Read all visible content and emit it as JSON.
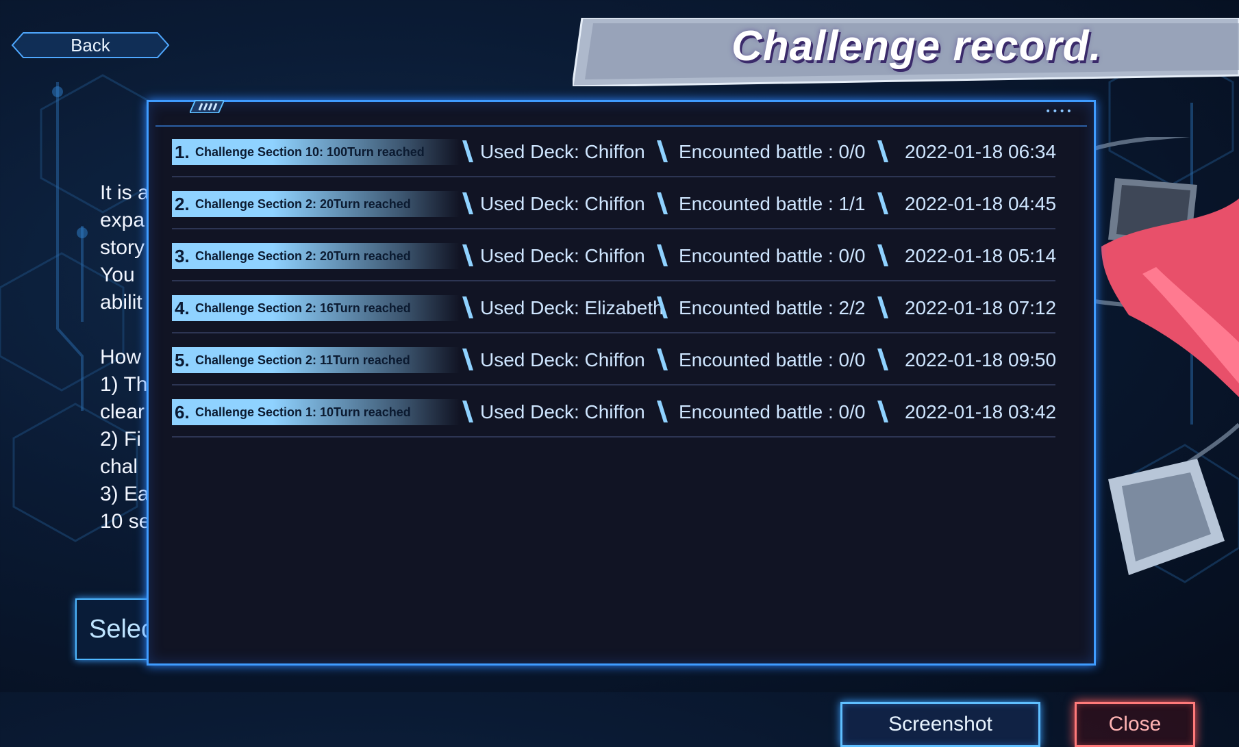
{
  "header": {
    "back_label": "Back",
    "title": "Challenge record."
  },
  "background": {
    "description_fragments": [
      "It is a",
      "expa",
      "story",
      "You",
      "abilit",
      "",
      "How",
      "1) Th",
      "clear",
      "2) Fi",
      "chal",
      "3) Ea",
      "10 se"
    ],
    "select_label": "Selec"
  },
  "records": [
    {
      "rank": "1.",
      "section": "Challenge Section 10: 100Turn reached",
      "deck": "Used Deck: Chiffon",
      "battle": "Encounted battle : 0/0",
      "date": "2022-01-18 06:34"
    },
    {
      "rank": "2.",
      "section": "Challenge Section 2: 20Turn reached",
      "deck": "Used Deck: Chiffon",
      "battle": "Encounted battle : 1/1",
      "date": "2022-01-18 04:45"
    },
    {
      "rank": "3.",
      "section": "Challenge Section 2: 20Turn reached",
      "deck": "Used Deck: Chiffon",
      "battle": "Encounted battle : 0/0",
      "date": "2022-01-18 05:14"
    },
    {
      "rank": "4.",
      "section": "Challenge Section 2: 16Turn reached",
      "deck": "Used Deck: Elizabeth",
      "battle": "Encounted battle : 2/2",
      "date": "2022-01-18 07:12"
    },
    {
      "rank": "5.",
      "section": "Challenge Section 2: 11Turn reached",
      "deck": "Used Deck: Chiffon",
      "battle": "Encounted battle : 0/0",
      "date": "2022-01-18 09:50"
    },
    {
      "rank": "6.",
      "section": "Challenge Section 1: 10Turn reached",
      "deck": "Used Deck: Chiffon",
      "battle": "Encounted battle : 0/0",
      "date": "2022-01-18 03:42"
    }
  ],
  "footer": {
    "screenshot_label": "Screenshot",
    "close_label": "Close"
  },
  "colors": {
    "accent_blue": "#3f9cff",
    "rank_fill": "#8fd2ff",
    "close_red": "#ff7a7a",
    "dialog_bg": "#111424"
  }
}
